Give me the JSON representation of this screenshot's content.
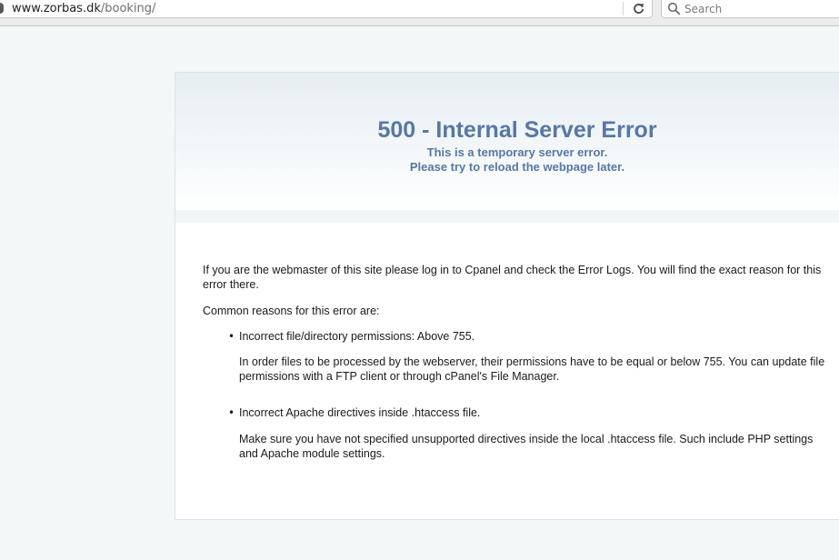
{
  "browser": {
    "url_domain": "www.zorbas.dk",
    "url_path": "/booking/",
    "search_placeholder": "Search"
  },
  "error": {
    "title": "500 - Internal Server Error",
    "subtitle_line1": "This is a temporary server error.",
    "subtitle_line2": "Please try to reload the webpage later."
  },
  "content": {
    "intro": "If you are the webmaster of this site please log in to Cpanel and check the Error Logs. You will find the exact reason for this error there.",
    "common_reasons": "Common reasons for this error are:",
    "reasons": [
      {
        "bullet": "•",
        "title": "Incorrect file/directory permissions: Above 755.",
        "detail": "In order files to be processed by the webserver, their permissions have to be equal or below 755. You can update file permissions with a FTP client or through cPanel's File Manager."
      },
      {
        "bullet": "•",
        "title": "Incorrect Apache directives inside .htaccess file.",
        "detail": "Make sure you have not specified unsupported directives inside the local .htaccess file. Such include PHP settings and Apache module settings."
      }
    ]
  },
  "colors": {
    "accent": "#5677a8",
    "background": "#f3f7f8"
  }
}
